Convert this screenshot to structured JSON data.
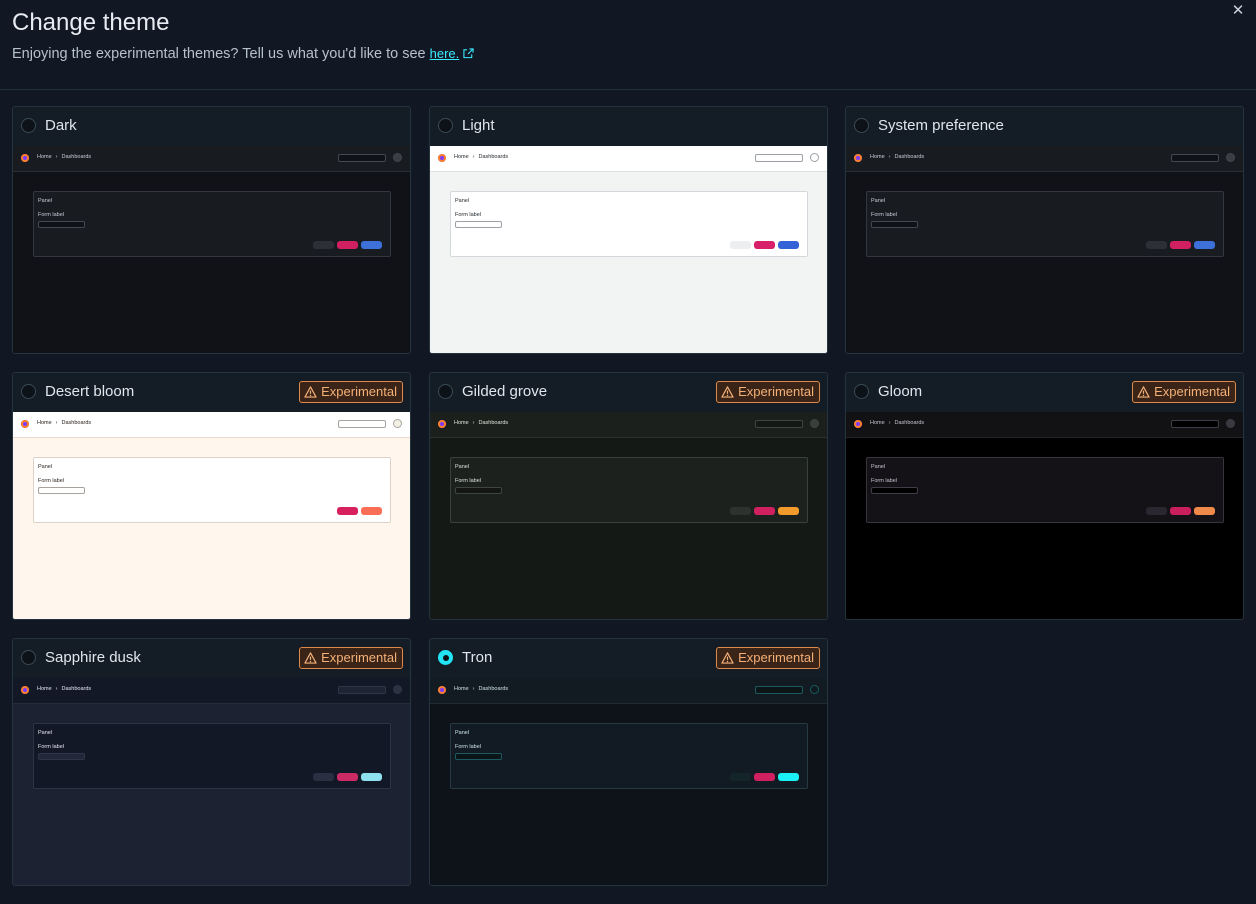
{
  "header": {
    "title": "Change theme",
    "subtitle": "Enjoying the experimental themes? Tell us what you'd like to see",
    "link_text": "here.",
    "close_icon": "close-icon",
    "external_link_icon": "external-link-icon"
  },
  "preview_labels": {
    "home": "Home",
    "separator": "›",
    "dashboards": "Dashboards",
    "panel": "Panel",
    "form_label": "Form label"
  },
  "badge_label": "Experimental",
  "themes": [
    {
      "name": "Dark",
      "experimental": false,
      "selected": false,
      "colors": {
        "bg": "#111217",
        "top": "#181b1f",
        "topBorder": "#2a2d33",
        "text": "#ccccdc",
        "search": "#111217",
        "searchBorder": "#44474f",
        "avatar": "#3a3d44",
        "panel": "#181b1f",
        "panelBorder": "#34373d",
        "input": "#111217",
        "inputBorder": "#44474f",
        "b1": "#2c2f36",
        "b2": "#d1205f",
        "b3": "#3d71d9"
      }
    },
    {
      "name": "Light",
      "experimental": false,
      "selected": false,
      "colors": {
        "bg": "#f2f4f4",
        "top": "#ffffff",
        "topBorder": "#dcdee2",
        "text": "#24292e",
        "search": "#ffffff",
        "searchBorder": "#9aa0a6",
        "avatar": "#ffffff",
        "panel": "#ffffff",
        "panelBorder": "#d4d7db",
        "input": "#ffffff",
        "inputBorder": "#9aa0a6",
        "b1": "#eceef0",
        "b2": "#d8206a",
        "b3": "#3463d8"
      }
    },
    {
      "name": "System preference",
      "experimental": false,
      "selected": false,
      "colors": {
        "bg": "#111217",
        "top": "#181b1f",
        "topBorder": "#2a2d33",
        "text": "#ccccdc",
        "search": "#111217",
        "searchBorder": "#44474f",
        "avatar": "#3a3d44",
        "panel": "#181b1f",
        "panelBorder": "#34373d",
        "input": "#111217",
        "inputBorder": "#44474f",
        "b1": "#2c2f36",
        "b2": "#d1205f",
        "b3": "#3d71d9"
      }
    },
    {
      "name": "Desert bloom",
      "experimental": true,
      "selected": false,
      "colors": {
        "bg": "#fff6ee",
        "top": "#ffffff",
        "topBorder": "#ead9cc",
        "text": "#2a2420",
        "search": "#ffffff",
        "searchBorder": "#a8a29c",
        "avatar": "#f3f1e4",
        "panel": "#ffffff",
        "panelBorder": "#dcd2ca",
        "input": "#ffffff",
        "inputBorder": "#a8a29c",
        "b1": "#ffffff",
        "b2": "#d8205e",
        "b3": "#fa6e55"
      }
    },
    {
      "name": "Gilded grove",
      "experimental": true,
      "selected": false,
      "colors": {
        "bg": "#151916",
        "top": "#1b201c",
        "topBorder": "#2b312c",
        "text": "#dfe3dc",
        "search": "#141714",
        "searchBorder": "#3e443f",
        "avatar": "#3a3f3b",
        "panel": "#1c211d",
        "panelBorder": "#3a403b",
        "input": "#131613",
        "inputBorder": "#3e443f",
        "b1": "#2d322e",
        "b2": "#d1205f",
        "b3": "#f39a2c"
      }
    },
    {
      "name": "Gloom",
      "experimental": true,
      "selected": false,
      "colors": {
        "bg": "#000000",
        "top": "#121114",
        "topBorder": "#24222a",
        "text": "#c9c6d2",
        "search": "#000000",
        "searchBorder": "#403c48",
        "avatar": "#3b3840",
        "panel": "#141216",
        "panelBorder": "#38343d",
        "input": "#000000",
        "inputBorder": "#403c48",
        "b1": "#2a2730",
        "b2": "#c91f5a",
        "b3": "#f08a4a"
      }
    },
    {
      "name": "Sapphire dusk",
      "experimental": true,
      "selected": false,
      "colors": {
        "bg": "#1c2232",
        "top": "#131826",
        "topBorder": "#262c3c",
        "text": "#e4e8f2",
        "search": "#1e2434",
        "searchBorder": "#2e3546",
        "avatar": "#2c3242",
        "panel": "#131826",
        "panelBorder": "#2c3344",
        "input": "#222839",
        "inputBorder": "#2e3546",
        "b1": "#2a3041",
        "b2": "#cc2a64",
        "b3": "#8fe0ee"
      }
    },
    {
      "name": "Tron",
      "experimental": true,
      "selected": true,
      "colors": {
        "bg": "#0e1219",
        "top": "#121a22",
        "topBorder": "#1f2c35",
        "text": "#cfe3ea",
        "search": "#0b1518",
        "searchBorder": "#1d5a60",
        "avatar": "#0e1a20",
        "panel": "#121b24",
        "panelBorder": "#263a44",
        "input": "#0b1518",
        "inputBorder": "#1d5a60",
        "b1": "#14252a",
        "b2": "#d1205f",
        "b3": "#1af0f5"
      }
    }
  ]
}
